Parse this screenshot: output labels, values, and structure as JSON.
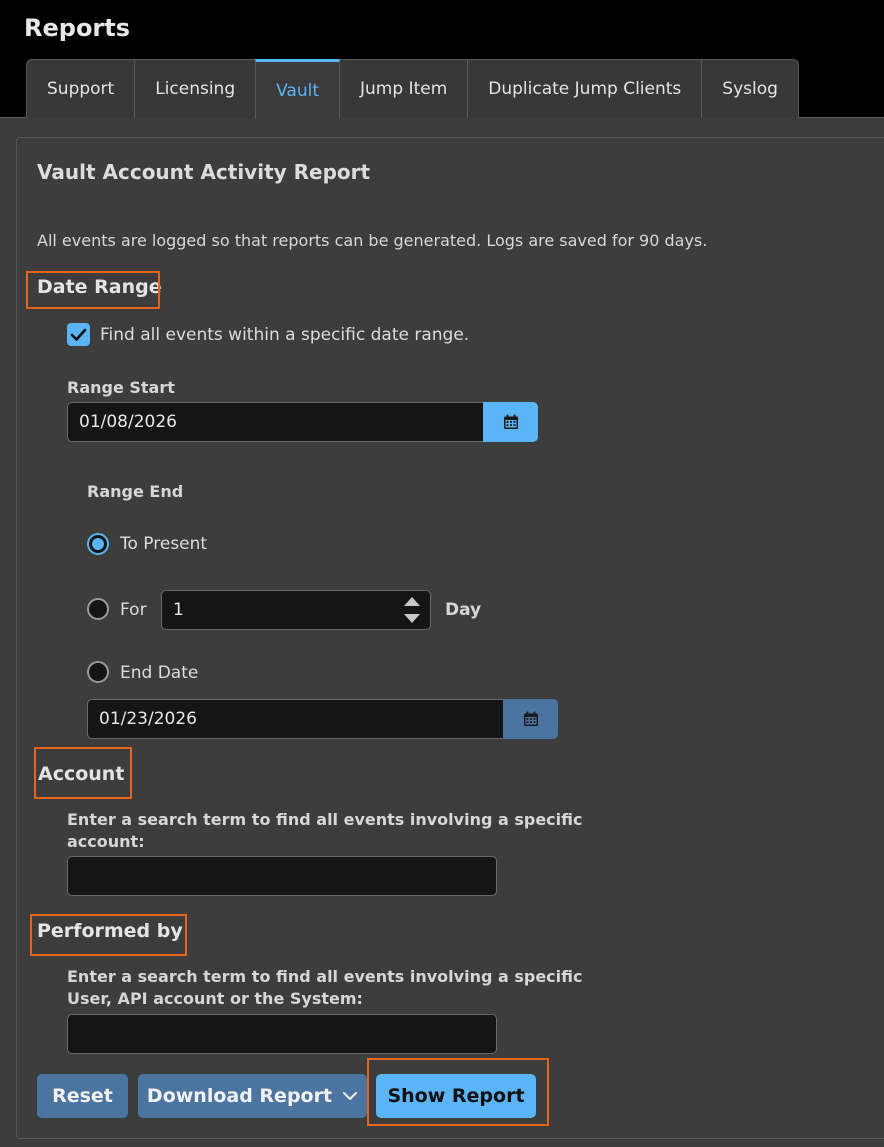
{
  "app": {
    "title": "Reports"
  },
  "tabs": [
    {
      "label": "Support",
      "active": false
    },
    {
      "label": "Licensing",
      "active": false
    },
    {
      "label": "Vault",
      "active": true
    },
    {
      "label": "Jump Item",
      "active": false
    },
    {
      "label": "Duplicate Jump Clients",
      "active": false
    },
    {
      "label": "Syslog",
      "active": false
    }
  ],
  "panel": {
    "title": "Vault Account Activity Report",
    "intro": "All events are logged so that reports can be generated. Logs are saved for 90 days."
  },
  "date_range": {
    "heading": "Date Range",
    "checkbox_label": "Find all events within a specific date range.",
    "checkbox_checked": true,
    "range_start": {
      "label": "Range Start",
      "value": "01/08/2026"
    },
    "range_end": {
      "label": "Range End",
      "options": {
        "to_present": "To Present",
        "for": "For",
        "end_date": "End Date"
      },
      "selected": "to_present",
      "for_value": "1",
      "for_unit": "Day",
      "end_date_value": "01/23/2026"
    }
  },
  "account": {
    "heading": "Account",
    "help_line1": "Enter a search term to find all events involving a specific",
    "help_line2": "account:",
    "value": ""
  },
  "performed_by": {
    "heading": "Performed by",
    "help_line1": "Enter a search term to find all events involving a specific",
    "help_line2": "User, API account or the System:",
    "value": ""
  },
  "actions": {
    "reset": "Reset",
    "download": "Download Report",
    "show": "Show Report"
  },
  "icons": {
    "calendar": "calendar-icon",
    "chevron": "chevron-down-icon",
    "check": "check-icon"
  },
  "colors": {
    "accent": "#5ab4f5",
    "secondary_button": "#4b74a1",
    "highlight": "#e8641c",
    "panel_bg": "#3d3d3d",
    "input_bg": "#151515"
  }
}
